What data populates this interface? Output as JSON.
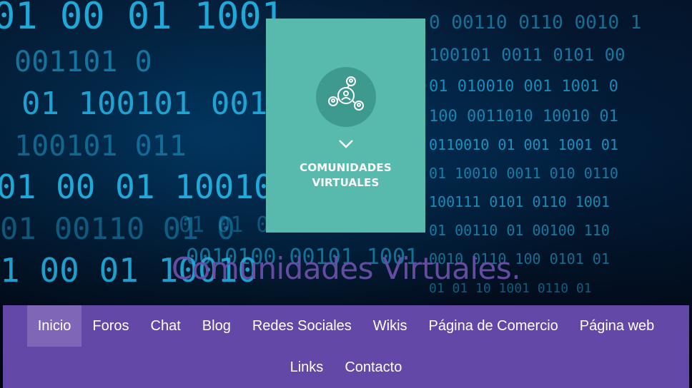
{
  "card": {
    "icon": "community-network-icon",
    "chevron_icon": "chevron-down-icon",
    "title_line1": "COMUNIDADES",
    "title_line2": "VIRTUALES"
  },
  "site": {
    "title": "Comunidades Virtuales."
  },
  "nav": {
    "row1": [
      {
        "label": "Inicio",
        "active": true
      },
      {
        "label": "Foros"
      },
      {
        "label": "Chat"
      },
      {
        "label": "Blog"
      },
      {
        "label": "Redes Sociales"
      },
      {
        "label": "Wikis"
      },
      {
        "label": "Página de Comercio"
      },
      {
        "label": "Página web"
      }
    ],
    "row2": [
      {
        "label": "Links"
      },
      {
        "label": "Contacto"
      }
    ]
  },
  "colors": {
    "card": "#58b9ad",
    "nav": "#6448a7",
    "nav_active": "#8066b6",
    "title": "#6a4fa8",
    "binary": "#1fb6e6"
  }
}
